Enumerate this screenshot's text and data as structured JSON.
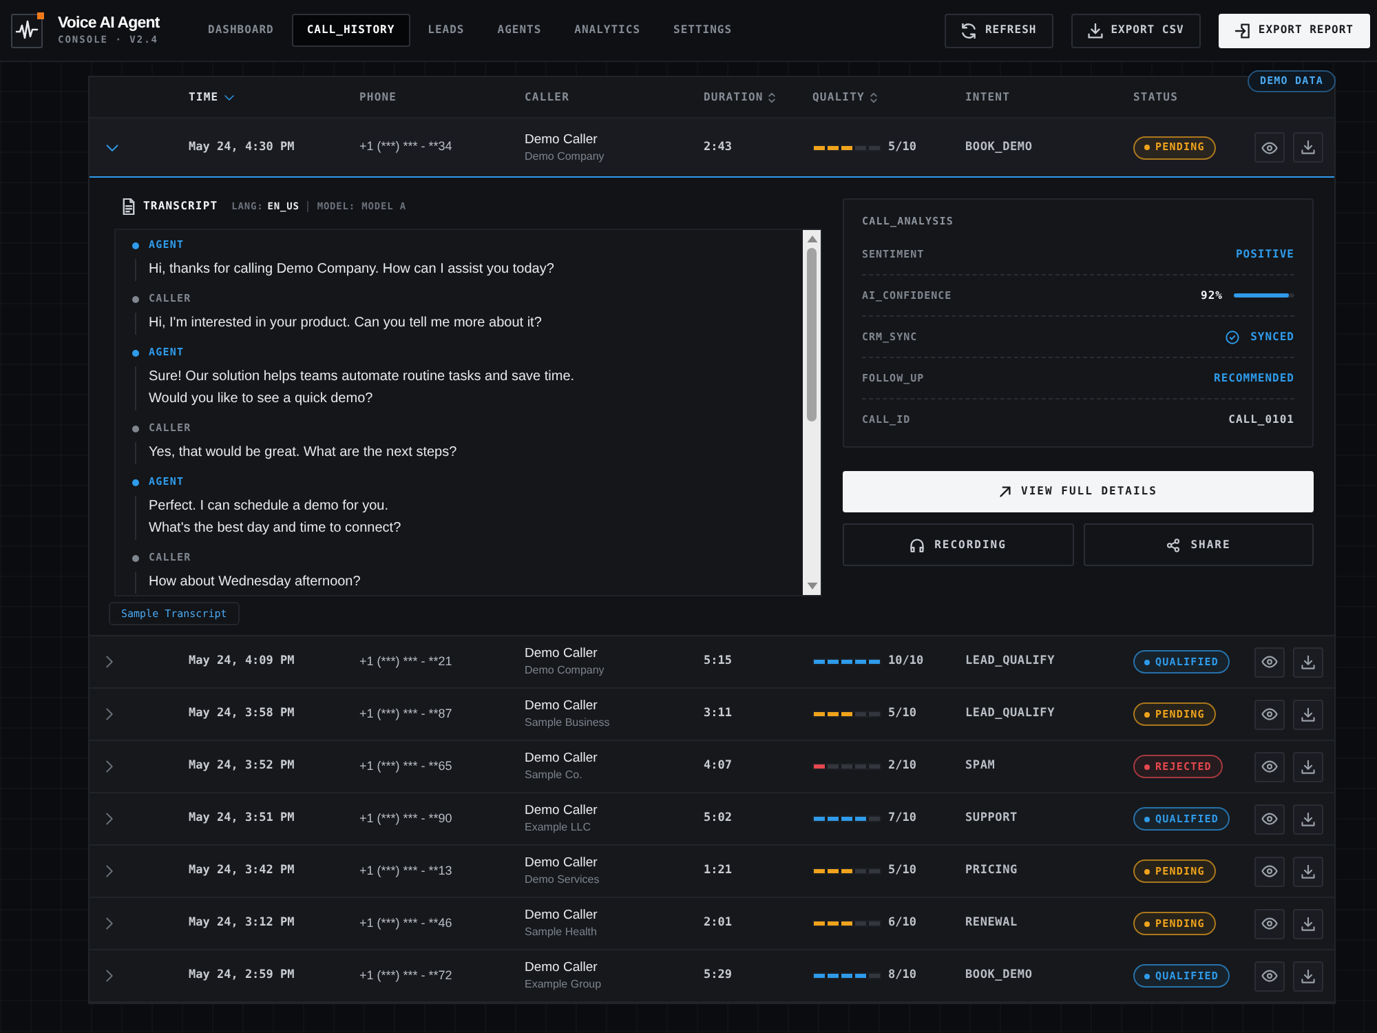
{
  "app": {
    "title": "Voice AI Agent",
    "subtitle": "CONSOLE · V2.4"
  },
  "nav": [
    {
      "label": "DASHBOARD",
      "selected": false
    },
    {
      "label": "CALL_HISTORY",
      "selected": true
    },
    {
      "label": "LEADS",
      "selected": false
    },
    {
      "label": "AGENTS",
      "selected": false
    },
    {
      "label": "ANALYTICS",
      "selected": false
    },
    {
      "label": "SETTINGS",
      "selected": false
    }
  ],
  "toolbar": [
    {
      "label": "REFRESH",
      "kind": "refresh",
      "primary": false
    },
    {
      "label": "EXPORT CSV",
      "kind": "download",
      "primary": false
    },
    {
      "label": "EXPORT REPORT",
      "kind": "export",
      "primary": true
    }
  ],
  "table": {
    "badge": "DEMO DATA",
    "columns": [
      {
        "label": "TIME",
        "sortable": true,
        "sorted": true
      },
      {
        "label": "PHONE",
        "sortable": false,
        "sorted": false
      },
      {
        "label": "CALLER",
        "sortable": false,
        "sorted": false
      },
      {
        "label": "DURATION",
        "sortable": true,
        "sorted": false
      },
      {
        "label": "QUALITY",
        "sortable": true,
        "sorted": false
      },
      {
        "label": "INTENT",
        "sortable": false,
        "sorted": false
      },
      {
        "label": "STATUS",
        "sortable": false,
        "sorted": false
      }
    ],
    "rows": [
      {
        "expanded": true,
        "time": "May 24, 4:30 PM",
        "phone": "+1 (***) *** - **34",
        "caller": "Demo Caller",
        "company": "Demo Company",
        "duration": "2:43",
        "quality": {
          "level": 0.6,
          "reading": "5/10",
          "color": "#f0a31c"
        },
        "intent": "BOOK_DEMO",
        "status": {
          "label": "PENDING",
          "color": "#f0a31c"
        },
        "details": {
          "transcript": {
            "title": "TRANSCRIPT",
            "lang_label": "LANG:",
            "lang": "EN_US",
            "model": "MODEL: MODEL A",
            "messages": [
              {
                "speaker": "AGENT",
                "kind": "agent",
                "lines": [
                  "Hi, thanks for calling Demo Company. How can I assist you today?"
                ]
              },
              {
                "speaker": "CALLER",
                "kind": "caller",
                "lines": [
                  "Hi, I'm interested in your product. Can you tell me more about it?"
                ]
              },
              {
                "speaker": "AGENT",
                "kind": "agent",
                "lines": [
                  "Sure! Our solution helps teams automate routine tasks and save time.",
                  "Would you like to see a quick demo?"
                ]
              },
              {
                "speaker": "CALLER",
                "kind": "caller",
                "lines": [
                  "Yes, that would be great. What are the next steps?"
                ]
              },
              {
                "speaker": "AGENT",
                "kind": "agent",
                "lines": [
                  "Perfect. I can schedule a demo for you.",
                  "What's the best day and time to connect?"
                ]
              },
              {
                "speaker": "CALLER",
                "kind": "caller",
                "lines": [
                  "How about Wednesday afternoon?"
                ]
              }
            ],
            "tag": "Sample Transcript"
          },
          "analysis": {
            "title": "CALL_ANALYSIS",
            "items": [
              {
                "label": "SENTIMENT",
                "value": "POSITIVE",
                "kind": "highlight"
              },
              {
                "label": "AI_CONFIDENCE",
                "value": "92%",
                "kind": "meter",
                "level": 0.92
              },
              {
                "label": "CRM_SYNC",
                "value": "SYNCED",
                "kind": "check"
              },
              {
                "label": "FOLLOW_UP",
                "value": "RECOMMENDED",
                "kind": "highlight"
              },
              {
                "label": "CALL_ID",
                "value": "CALL_0101",
                "kind": "plain"
              }
            ]
          },
          "buttons": [
            {
              "label": "VIEW FULL DETAILS",
              "kind": "details",
              "primary": true
            },
            {
              "label": "RECORDING",
              "kind": "recording",
              "primary": false
            },
            {
              "label": "SHARE",
              "kind": "share",
              "primary": false
            }
          ]
        }
      },
      {
        "expanded": false,
        "time": "May 24, 4:09 PM",
        "phone": "+1 (***) *** - **21",
        "caller": "Demo Caller",
        "company": "Demo Company",
        "duration": "5:15",
        "quality": {
          "level": 1,
          "reading": "10/10",
          "color": "#2f9bea"
        },
        "intent": "LEAD_QUALIFY",
        "status": {
          "label": "QUALIFIED",
          "color": "#2f9bea"
        }
      },
      {
        "expanded": false,
        "time": "May 24, 3:58 PM",
        "phone": "+1 (***) *** - **87",
        "caller": "Demo Caller",
        "company": "Sample Business",
        "duration": "3:11",
        "quality": {
          "level": 0.6,
          "reading": "5/10",
          "color": "#f0a31c"
        },
        "intent": "LEAD_QUALIFY",
        "status": {
          "label": "PENDING",
          "color": "#f0a31c"
        }
      },
      {
        "expanded": false,
        "time": "May 24, 3:52 PM",
        "phone": "+1 (***) *** - **65",
        "caller": "Demo Caller",
        "company": "Sample Co.",
        "duration": "4:07",
        "quality": {
          "level": 0.2,
          "reading": "2/10",
          "color": "#e5484d"
        },
        "intent": "SPAM",
        "status": {
          "label": "REJECTED",
          "color": "#e5484d"
        }
      },
      {
        "expanded": false,
        "time": "May 24, 3:51 PM",
        "phone": "+1 (***) *** - **90",
        "caller": "Demo Caller",
        "company": "Example LLC",
        "duration": "5:02",
        "quality": {
          "level": 0.8,
          "reading": "7/10",
          "color": "#2f9bea"
        },
        "intent": "SUPPORT",
        "status": {
          "label": "QUALIFIED",
          "color": "#2f9bea"
        }
      },
      {
        "expanded": false,
        "time": "May 24, 3:42 PM",
        "phone": "+1 (***) *** - **13",
        "caller": "Demo Caller",
        "company": "Demo Services",
        "duration": "1:21",
        "quality": {
          "level": 0.6,
          "reading": "5/10",
          "color": "#f0a31c"
        },
        "intent": "PRICING",
        "status": {
          "label": "PENDING",
          "color": "#f0a31c"
        }
      },
      {
        "expanded": false,
        "time": "May 24, 3:12 PM",
        "phone": "+1 (***) *** - **46",
        "caller": "Demo Caller",
        "company": "Sample Health",
        "duration": "2:01",
        "quality": {
          "level": 0.6,
          "reading": "6/10",
          "color": "#f0a31c"
        },
        "intent": "RENEWAL",
        "status": {
          "label": "PENDING",
          "color": "#f0a31c"
        }
      },
      {
        "expanded": false,
        "time": "May 24, 2:59 PM",
        "phone": "+1 (***) *** - **72",
        "caller": "Demo Caller",
        "company": "Example Group",
        "duration": "5:29",
        "quality": {
          "level": 0.8,
          "reading": "8/10",
          "color": "#2f9bea"
        },
        "intent": "BOOK_DEMO",
        "status": {
          "label": "QUALIFIED",
          "color": "#2f9bea"
        }
      }
    ]
  }
}
